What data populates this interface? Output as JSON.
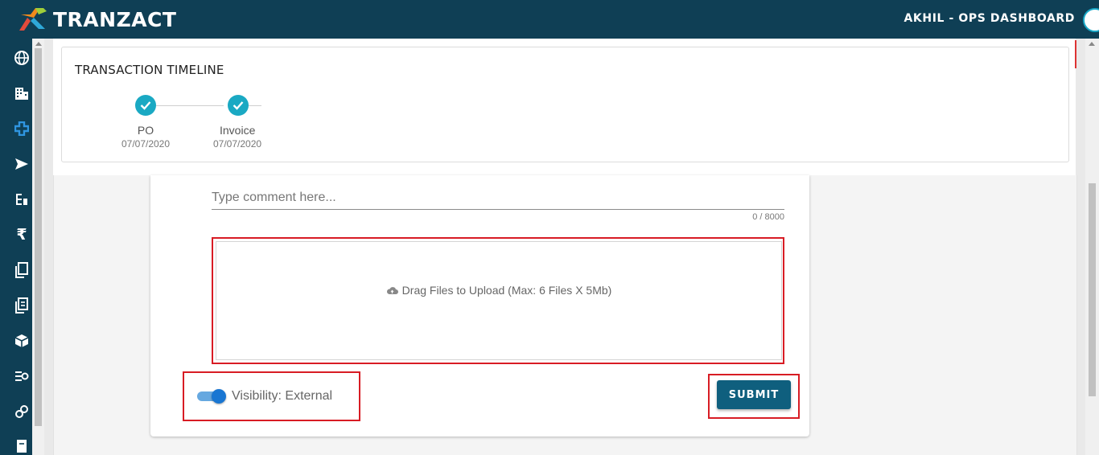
{
  "header": {
    "logo_text": "TRANZACT",
    "user_title": "AKHIL - OPS DASHBOARD"
  },
  "sidebar": {
    "icons": [
      "globe-icon",
      "building-icon",
      "plus-icon",
      "send-icon",
      "list-icon",
      "rupee-icon",
      "copy-icon",
      "document-icon",
      "box-icon",
      "filter-icon",
      "link-icon",
      "file-icon"
    ]
  },
  "timeline": {
    "title": "TRANSACTION TIMELINE",
    "steps": [
      {
        "name": "PO",
        "date": "07/07/2020"
      },
      {
        "name": "Invoice",
        "date": "07/07/2020"
      }
    ]
  },
  "comment": {
    "placeholder": "Type comment here...",
    "counter": "0 / 8000"
  },
  "upload": {
    "label": "Drag Files to Upload (Max: 6 Files X 5Mb)"
  },
  "visibility": {
    "label": "Visibility: External",
    "enabled": true
  },
  "actions": {
    "submit_label": "SUBMIT"
  },
  "colors": {
    "navbar": "#0f3f55",
    "accent": "#1aa9c3",
    "highlight": "#d81c24",
    "button": "#0f5f7e"
  }
}
